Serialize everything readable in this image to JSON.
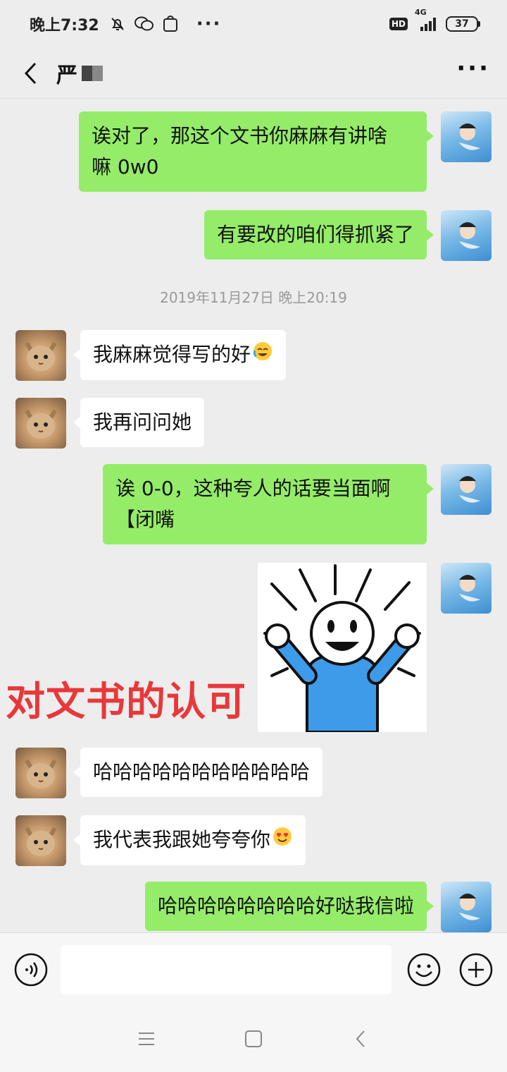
{
  "status_bar": {
    "time": "晚上7:32",
    "network": "4G",
    "hd": "HD",
    "battery": "37"
  },
  "nav": {
    "title": "严"
  },
  "messages": [
    {
      "side": "out",
      "type": "text",
      "lines": [
        "诶对了，那这个文书你麻麻有讲啥",
        "嘛 0w0"
      ]
    },
    {
      "side": "out",
      "type": "text",
      "lines": [
        "有要改的咱们得抓紧了"
      ]
    },
    {
      "type": "timestamp",
      "text": "2019年11月27日 晚上20:19"
    },
    {
      "side": "in",
      "type": "text",
      "lines": [
        "我麻麻觉得写的好"
      ],
      "emoji": "crying-laughing-emoji"
    },
    {
      "side": "in",
      "type": "text",
      "lines": [
        "我再问问她"
      ]
    },
    {
      "side": "out",
      "type": "text",
      "lines": [
        "诶 0-0，这种夸人的话要当面啊",
        "【闭嘴"
      ]
    },
    {
      "side": "out",
      "type": "sticker",
      "sticker": "cheering-stickman"
    },
    {
      "side": "in",
      "type": "text",
      "lines": [
        "哈哈哈哈哈哈哈哈哈哈哈"
      ]
    },
    {
      "side": "in",
      "type": "text",
      "lines": [
        "我代表我跟她夸夸你"
      ],
      "emoji": "heart-eyes-emoji"
    },
    {
      "side": "out",
      "type": "text",
      "lines": [
        "哈哈哈哈哈哈哈哈好哒我信啦"
      ]
    }
  ],
  "overlay": {
    "caption": "对文书的认可",
    "color": "#e8383a"
  },
  "colors": {
    "bubble_out": "#95ec69",
    "bubble_in": "#ffffff",
    "background": "#ededed"
  },
  "icons": {
    "voice": "voice-icon",
    "emoji": "emoji-icon",
    "plus": "plus-icon"
  }
}
